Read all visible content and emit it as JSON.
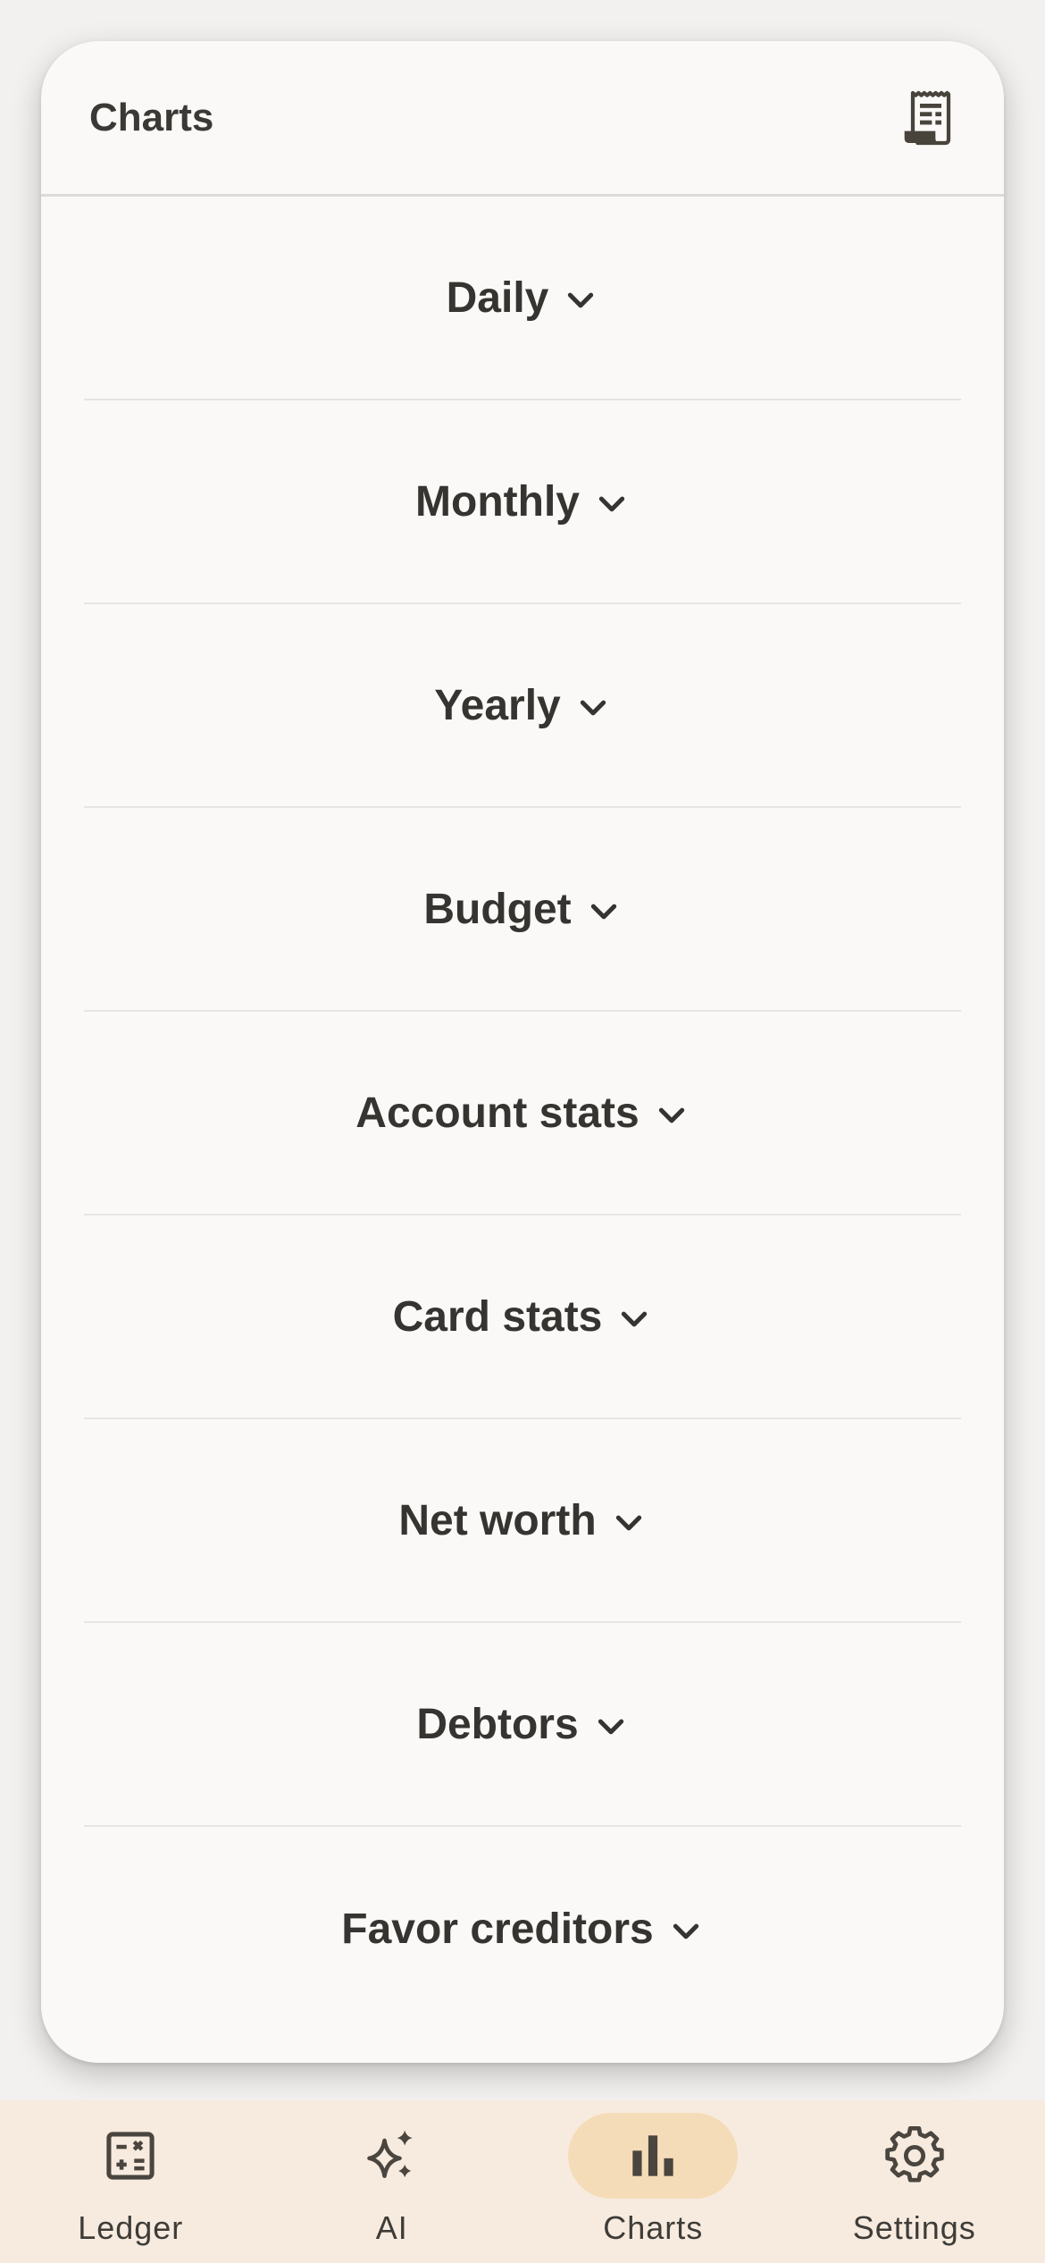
{
  "header": {
    "title": "Charts",
    "action_icon": "receipt-icon"
  },
  "sections": [
    {
      "label": "Daily"
    },
    {
      "label": "Monthly"
    },
    {
      "label": "Yearly"
    },
    {
      "label": "Budget"
    },
    {
      "label": "Account stats"
    },
    {
      "label": "Card stats"
    },
    {
      "label": "Net worth"
    },
    {
      "label": "Debtors"
    },
    {
      "label": "Favor creditors"
    }
  ],
  "bottom_nav": {
    "items": [
      {
        "label": "Ledger",
        "icon": "calculator-icon"
      },
      {
        "label": "AI",
        "icon": "sparkle-icon"
      },
      {
        "label": "Charts",
        "icon": "bar-chart-icon",
        "active": true
      },
      {
        "label": "Settings",
        "icon": "gear-icon"
      }
    ]
  },
  "colors": {
    "card_background": "#faf9f7",
    "page_background": "#f2f1ef",
    "nav_background": "#f7ebdf",
    "active_pill": "#f5dcb9",
    "text": "#353431"
  }
}
